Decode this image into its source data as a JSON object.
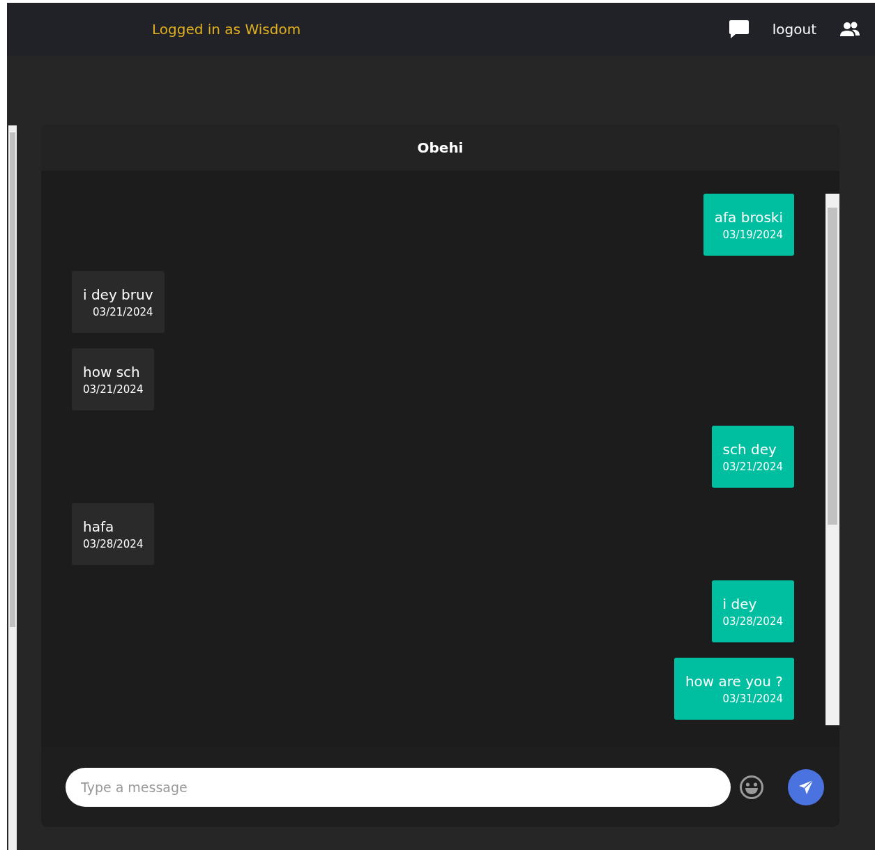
{
  "header": {
    "user_label": "Logged in as Wisdom",
    "logout": "logout"
  },
  "chat": {
    "title": "Obehi",
    "messages": [
      {
        "kind": "sent",
        "text": "afa broski",
        "date": "03/19/2024"
      },
      {
        "kind": "received",
        "text": "i dey bruv",
        "date": "03/21/2024"
      },
      {
        "kind": "received",
        "text": "how sch",
        "date": "03/21/2024"
      },
      {
        "kind": "sent",
        "text": "sch dey",
        "date": "03/21/2024"
      },
      {
        "kind": "received",
        "text": "hafa",
        "date": "03/28/2024"
      },
      {
        "kind": "sent",
        "text": "i dey",
        "date": "03/28/2024"
      },
      {
        "kind": "sent",
        "text": "how are you ?",
        "date": "03/31/2024"
      }
    ],
    "input": {
      "placeholder": "Type a message"
    }
  }
}
